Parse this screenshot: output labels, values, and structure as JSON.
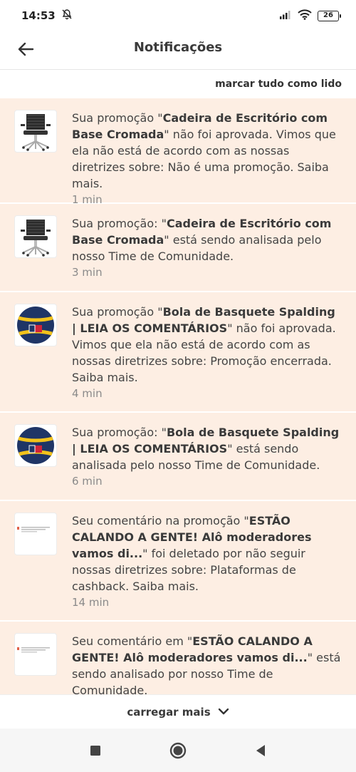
{
  "status": {
    "time": "14:53",
    "battery": "26"
  },
  "header": {
    "title": "Notificações"
  },
  "actions": {
    "mark_all": "marcar tudo como lido",
    "load_more": "carregar mais"
  },
  "notifications": [
    {
      "thumb": "office-chair",
      "pre": "Sua promoção \"",
      "bold": "Cadeira de Escritório com Base Cromada",
      "post": "\" não foi aprovada. Vimos que ela não está de acordo com as nossas diretrizes sobre: Não é uma promoção. Saiba mais.",
      "time": "1 min"
    },
    {
      "thumb": "office-chair",
      "pre": "Sua promoção: \"",
      "bold": "Cadeira de Escritório com Base Cromada",
      "post": "\" está sendo analisada pelo nosso Time de Comunidade.",
      "time": "3 min"
    },
    {
      "thumb": "basketball",
      "pre": "Sua promoção \"",
      "bold": "Bola de Basquete Spalding | LEIA OS COMENTÁRIOS",
      "post": "\" não foi aprovada. Vimos que ela não está de acordo com as nossas diretrizes sobre: Promoção encerrada. Saiba mais.",
      "time": "4 min"
    },
    {
      "thumb": "basketball",
      "pre": "Sua promoção: \"",
      "bold": "Bola de Basquete Spalding | LEIA OS COMENTÁRIOS",
      "post": "\" está sendo analisada pelo nosso Time de Comunidade.",
      "time": "6 min"
    },
    {
      "thumb": "post-screenshot",
      "pre": "Seu comentário na promoção \"",
      "bold": "ESTÃO CALANDO A GENTE! Alô moderadores vamos di...",
      "post": "\" foi deletado por não seguir nossas diretrizes sobre: Plataformas de cashback. Saiba mais.",
      "time": "14 min"
    },
    {
      "thumb": "post-screenshot",
      "pre": "Seu comentário em \"",
      "bold": "ESTÃO CALANDO A GENTE! Alô moderadores vamos di...",
      "post": "\" está sendo analisado por nosso Time de Comunidade.",
      "time": ""
    }
  ],
  "colors": {
    "highlight_bg": "#fdeee3",
    "ball_blue": "#1f3566",
    "ball_yellow": "#f2c21b"
  }
}
